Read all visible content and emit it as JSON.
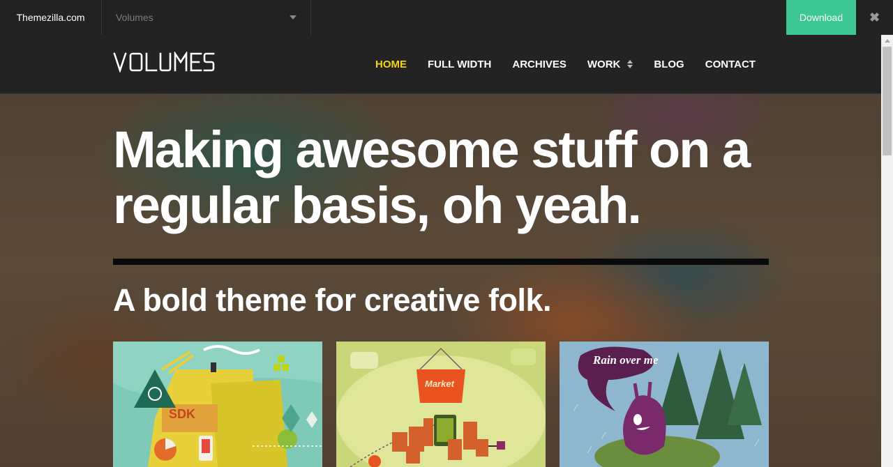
{
  "demo_bar": {
    "brand": "Themezilla.com",
    "theme_select": "Volumes",
    "download_label": "Download",
    "close_glyph": "✖",
    "download_color": "#3cc795"
  },
  "header": {
    "logo": "VOLUMES",
    "nav": [
      {
        "label": "HOME",
        "active": true
      },
      {
        "label": "FULL WIDTH"
      },
      {
        "label": "ARCHIVES"
      },
      {
        "label": "WORK",
        "has_dropdown": true
      },
      {
        "label": "BLOG"
      },
      {
        "label": "CONTACT"
      }
    ],
    "active_color": "#f5d219"
  },
  "hero": {
    "headline": "Making awesome stuff on a regular basis, oh yeah.",
    "subhead": "A bold theme for creative folk."
  },
  "portfolio": [
    {
      "label": "SDK"
    },
    {
      "label": "Market"
    },
    {
      "label": "Rain over me"
    }
  ]
}
